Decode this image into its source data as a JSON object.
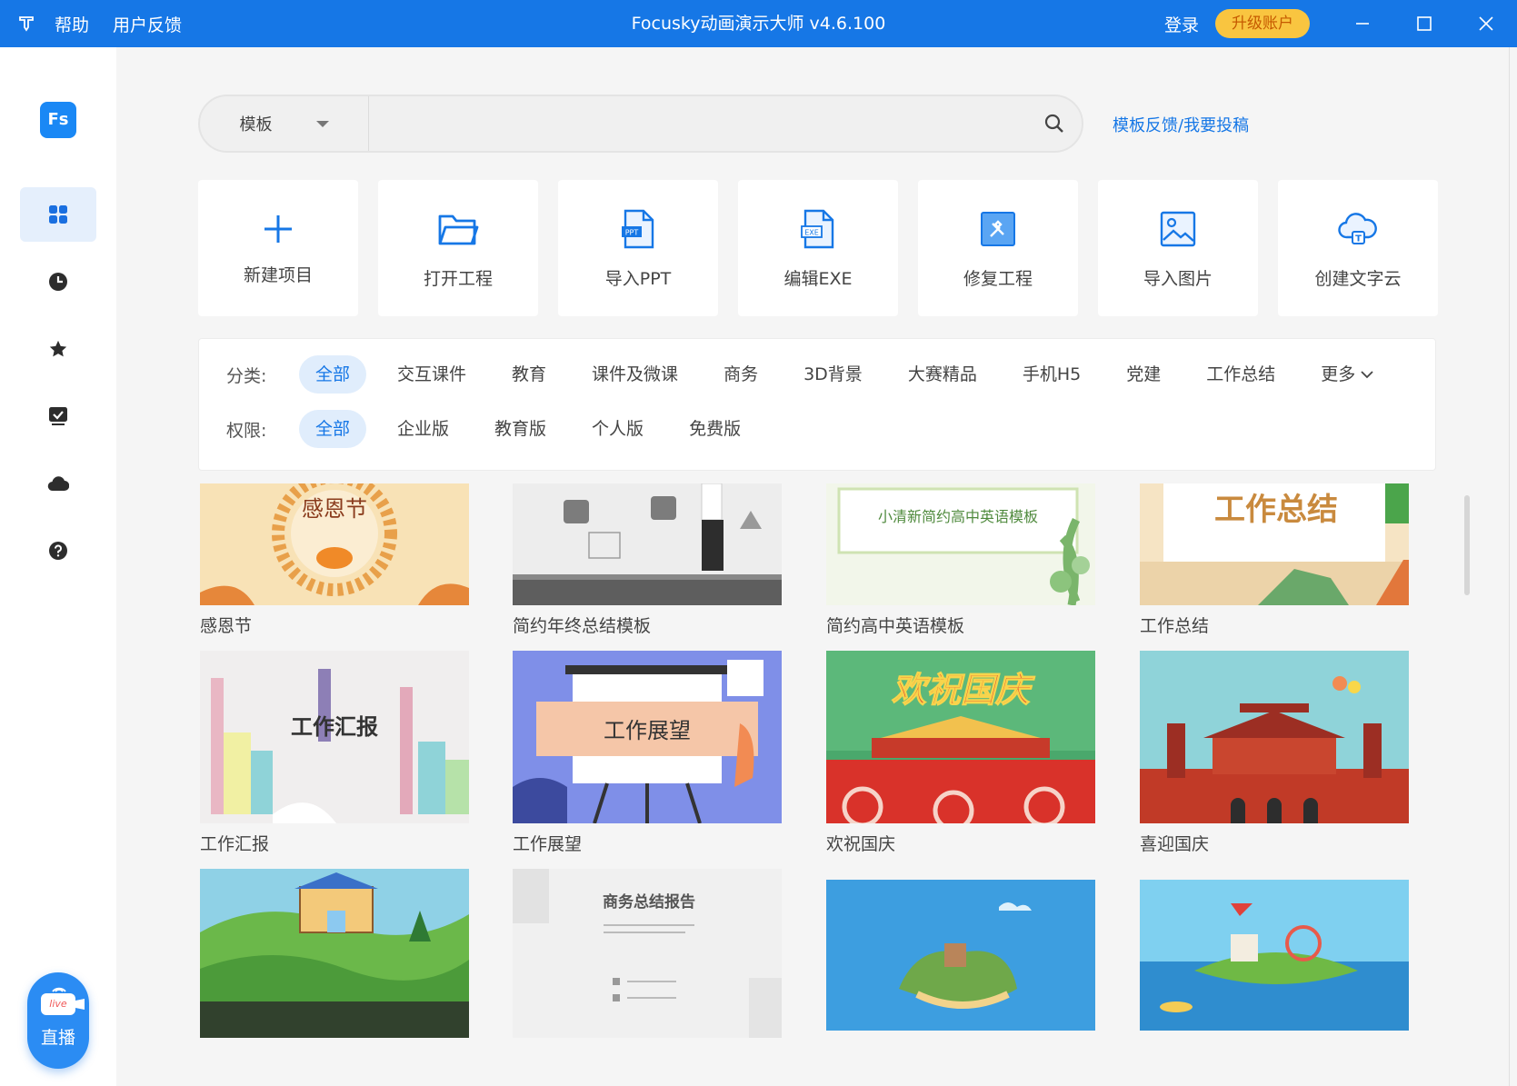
{
  "titlebar": {
    "menu": [
      "帮助",
      "用户反馈"
    ],
    "title": "Focusky动画演示大师 v4.6.100",
    "login": "登录",
    "upgrade": "升级账户"
  },
  "sidebar": {
    "logo": "Fs",
    "items": [
      "apps-icon",
      "clock-icon",
      "star-icon",
      "checkbox-icon",
      "cloud-icon",
      "help-icon"
    ],
    "live_badge": "live",
    "live_label": "直播"
  },
  "search": {
    "type": "模板",
    "value": "",
    "placeholder": ""
  },
  "feedback_link": "模板反馈/我要投稿",
  "actions": [
    {
      "label": "新建项目",
      "icon": "plus-icon"
    },
    {
      "label": "打开工程",
      "icon": "folder-icon"
    },
    {
      "label": "导入PPT",
      "icon": "ppt-icon",
      "tag": "PPT"
    },
    {
      "label": "编辑EXE",
      "icon": "exe-icon",
      "tag": "EXE"
    },
    {
      "label": "修复工程",
      "icon": "repair-icon"
    },
    {
      "label": "导入图片",
      "icon": "image-icon"
    },
    {
      "label": "创建文字云",
      "icon": "word-cloud-icon",
      "tag": "T"
    }
  ],
  "filters": {
    "category_label": "分类:",
    "categories": [
      "全部",
      "交互课件",
      "教育",
      "课件及微课",
      "商务",
      "3D背景",
      "大赛精品",
      "手机H5",
      "党建",
      "工作总结"
    ],
    "more": "更多",
    "permission_label": "权限:",
    "permissions": [
      "全部",
      "企业版",
      "教育版",
      "个人版",
      "免费版"
    ]
  },
  "templates": [
    {
      "caption": "感恩节",
      "title": "感恩节"
    },
    {
      "caption": "简约年终总结模板",
      "title": ""
    },
    {
      "caption": "简约高中英语模板",
      "title": "小清新简约高中英语模板"
    },
    {
      "caption": "工作总结",
      "title": "工作总结"
    },
    {
      "caption": "工作汇报",
      "title": "工作汇报"
    },
    {
      "caption": "工作展望",
      "title": "工作展望"
    },
    {
      "caption": "欢祝国庆",
      "title": "欢祝国庆"
    },
    {
      "caption": "喜迎国庆",
      "title": ""
    },
    {
      "caption": "",
      "title": ""
    },
    {
      "caption": "",
      "title": "商务总结报告"
    },
    {
      "caption": "",
      "title": ""
    },
    {
      "caption": "",
      "title": ""
    }
  ],
  "colors": {
    "brand": "#1677e6",
    "upgrade": "#f9c540",
    "active_chip_bg": "#e0edfc"
  }
}
